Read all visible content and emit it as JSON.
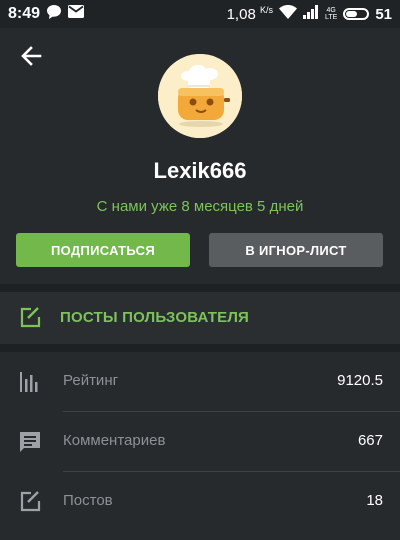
{
  "status_bar": {
    "time": "8:49",
    "speed": "1,08",
    "speed_unit": "K/s",
    "network": "4G",
    "network_sub": "LTE",
    "battery": "51"
  },
  "profile": {
    "username": "Lexik666",
    "member_since": "С нами уже 8 месяцев 5 дней",
    "subscribe_label": "ПОДПИСАТЬСЯ",
    "ignore_label": "В ИГНОР-ЛИСТ"
  },
  "posts_link": {
    "label": "ПОСТЫ ПОЛЬЗОВАТЕЛЯ"
  },
  "stats": [
    {
      "label": "Рейтинг",
      "value": "9120.5",
      "icon": "bar-chart-icon"
    },
    {
      "label": "Комментариев",
      "value": "667",
      "icon": "comment-icon"
    },
    {
      "label": "Постов",
      "value": "18",
      "icon": "edit-icon"
    }
  ],
  "colors": {
    "accent": "#7cc35a",
    "subscribe": "#72b84b",
    "ignore": "#5a5d60",
    "background": "#262a2d"
  }
}
